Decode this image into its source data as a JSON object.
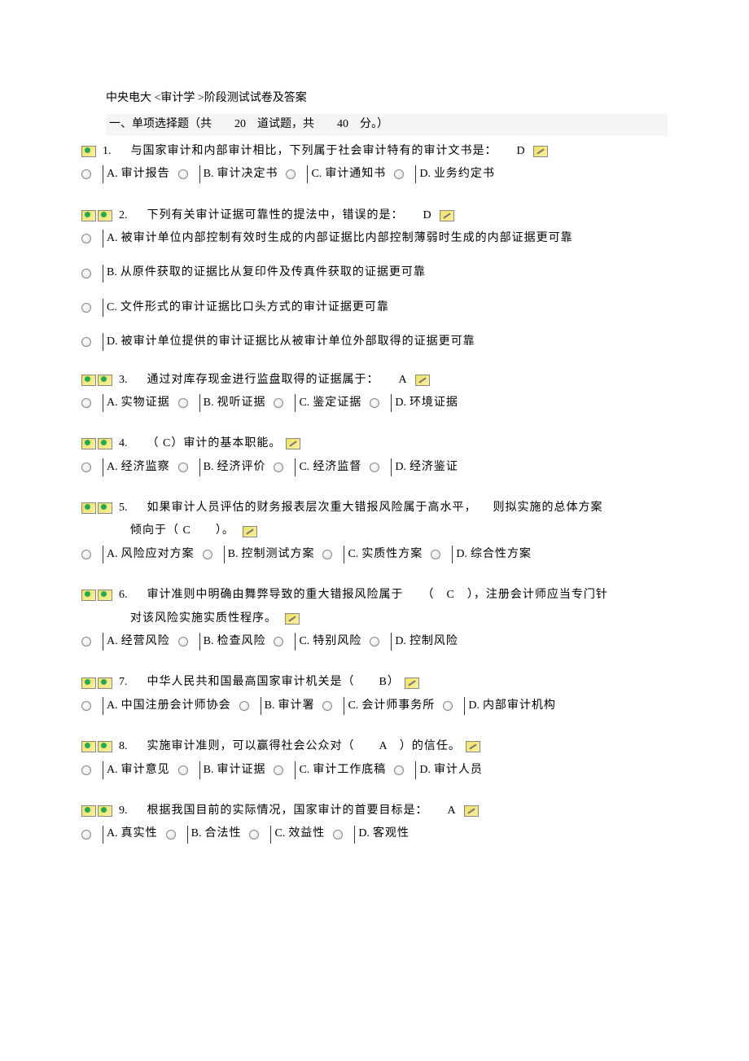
{
  "header": {
    "title": "中央电大 <审计学 >阶段测试试卷及答案",
    "section": "一、单项选择题（共　　20　道试题，共　　40　分。）"
  },
  "questions": [
    {
      "num": "1.",
      "text": "与国家审计和内部审计相比，下列属于社会审计特有的审计文书是：",
      "answer": "D",
      "trail_markers": 1,
      "lead_markers": 1,
      "layout": "row",
      "options": [
        {
          "label": "A.",
          "text": "审计报告"
        },
        {
          "label": "B.",
          "text": "审计决定书"
        },
        {
          "label": "C.",
          "text": "审计通知书"
        },
        {
          "label": "D.",
          "text": "业务约定书"
        }
      ]
    },
    {
      "num": "2.",
      "text": "下列有关审计证据可靠性的提法中，错误的是：",
      "answer": "D",
      "trail_markers": 1,
      "lead_markers": 2,
      "layout": "col",
      "options": [
        {
          "label": "A.",
          "text": "被审计单位内部控制有效时生成的内部证据比内部控制薄弱时生成的内部证据更可靠"
        },
        {
          "label": "B.",
          "text": "从原件获取的证据比从复印件及传真件获取的证据更可靠"
        },
        {
          "label": "C.",
          "text": "文件形式的审计证据比口头方式的审计证据更可靠"
        },
        {
          "label": "D.",
          "text": "被审计单位提供的审计证据比从被审计单位外部取得的证据更可靠"
        }
      ]
    },
    {
      "num": "3.",
      "text": "通过对库存现金进行监盘取得的证据属于：",
      "answer": "A",
      "trail_markers": 1,
      "lead_markers": 2,
      "layout": "row",
      "options": [
        {
          "label": "A.",
          "text": "实物证据"
        },
        {
          "label": "B.",
          "text": "视听证据"
        },
        {
          "label": "C.",
          "text": "鉴定证据"
        },
        {
          "label": "D.",
          "text": "环境证据"
        }
      ]
    },
    {
      "num": "4.",
      "text": "（ C）审计的基本职能。",
      "answer": "",
      "trail_markers": 1,
      "lead_markers": 2,
      "layout": "row",
      "options": [
        {
          "label": "A.",
          "text": "经济监察"
        },
        {
          "label": "B.",
          "text": "经济评价"
        },
        {
          "label": "C.",
          "text": "经济监督"
        },
        {
          "label": "D.",
          "text": "经济鉴证"
        }
      ]
    },
    {
      "num": "5.",
      "text": "如果审计人员评估的财务报表层次重大错报风险属于高水平，",
      "text2": "倾向于（ C　　）。",
      "tail_text": "则拟实施的总体方案",
      "answer": "",
      "trail_markers": 0,
      "cont_markers": 1,
      "lead_markers": 2,
      "layout": "row",
      "options": [
        {
          "label": "A.",
          "text": "风险应对方案"
        },
        {
          "label": "B.",
          "text": "控制测试方案"
        },
        {
          "label": "C.",
          "text": "实质性方案"
        },
        {
          "label": "D.",
          "text": "综合性方案"
        }
      ]
    },
    {
      "num": "6.",
      "text": "审计准则中明确由舞弊导致的重大错报风险属于　　（　C　），注册会计师应当专门针",
      "text2": "对该风险实施实质性程序。",
      "answer": "",
      "trail_markers": 0,
      "cont_markers": 1,
      "lead_markers": 2,
      "layout": "row",
      "options": [
        {
          "label": "A.",
          "text": "经营风险"
        },
        {
          "label": "B.",
          "text": "检查风险"
        },
        {
          "label": "C.",
          "text": "特别风险"
        },
        {
          "label": "D.",
          "text": "控制风险"
        }
      ]
    },
    {
      "num": "7.",
      "text": "中华人民共和国最高国家审计机关是（　　B）",
      "answer": "",
      "trail_markers": 1,
      "lead_markers": 2,
      "layout": "row",
      "options": [
        {
          "label": "A.",
          "text": "中国注册会计师协会"
        },
        {
          "label": "B.",
          "text": "审计署"
        },
        {
          "label": "C.",
          "text": "会计师事务所"
        },
        {
          "label": "D.",
          "text": "内部审计机构"
        }
      ]
    },
    {
      "num": "8.",
      "text": "实施审计准则，可以赢得社会公众对（　　A　）的信任。",
      "answer": "",
      "trail_markers": 1,
      "lead_markers": 2,
      "layout": "row",
      "options": [
        {
          "label": "A.",
          "text": "审计意见"
        },
        {
          "label": "B.",
          "text": "审计证据"
        },
        {
          "label": "C.",
          "text": "审计工作底稿"
        },
        {
          "label": "D.",
          "text": "审计人员"
        }
      ]
    },
    {
      "num": "9.",
      "text": "根据我国目前的实际情况，国家审计的首要目标是：",
      "answer": "A",
      "trail_markers": 1,
      "lead_markers": 2,
      "layout": "row",
      "options": [
        {
          "label": "A.",
          "text": "真实性"
        },
        {
          "label": "B.",
          "text": "合法性"
        },
        {
          "label": "C.",
          "text": "效益性"
        },
        {
          "label": "D.",
          "text": "客观性"
        }
      ]
    }
  ]
}
